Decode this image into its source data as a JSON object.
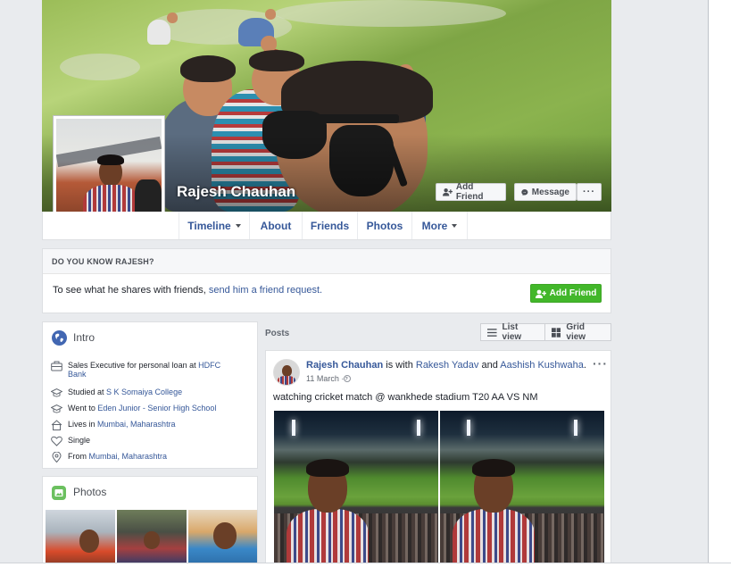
{
  "profile": {
    "name": "Rajesh Chauhan",
    "add_friend_label": "Add Friend",
    "message_label": "Message",
    "more_options": "···"
  },
  "nav": {
    "tabs": [
      {
        "label": "Timeline"
      },
      {
        "label": "About"
      },
      {
        "label": "Friends"
      },
      {
        "label": "Photos"
      },
      {
        "label": "More"
      }
    ]
  },
  "know": {
    "heading": "DO YOU KNOW RAJESH?",
    "text": "To see what he shares with friends, ",
    "link": "send him a friend request.",
    "button": "Add Friend"
  },
  "intro": {
    "title": "Intro",
    "rows": [
      {
        "prefix": "Sales Executive for personal loan at ",
        "link": "HDFC Bank"
      },
      {
        "prefix": "Studied at ",
        "link": "S K Somaiya College"
      },
      {
        "prefix": "Went to ",
        "link": "Eden Junior - Senior High School"
      },
      {
        "prefix": "Lives in ",
        "link": "Mumbai, Maharashtra"
      },
      {
        "prefix": "Single",
        "link": ""
      },
      {
        "prefix": "From ",
        "link": "Mumbai, Maharashtra"
      }
    ]
  },
  "photos": {
    "title": "Photos"
  },
  "posts": {
    "label": "Posts",
    "list_view": "List view",
    "grid_view": "Grid view"
  },
  "post": {
    "author": "Rajesh Chauhan",
    "with_text": " is with ",
    "friend1": "Rakesh Yadav",
    "and_text": " and ",
    "friend2": "Aashish Kushwaha",
    "period": ".",
    "time": "11 March · ",
    "text": "watching cricket match @ wankhede stadium T20 AA VS NM",
    "options": "···"
  },
  "colors": {
    "link": "#365899",
    "green": "#42b72a",
    "background": "#e9ebee"
  }
}
